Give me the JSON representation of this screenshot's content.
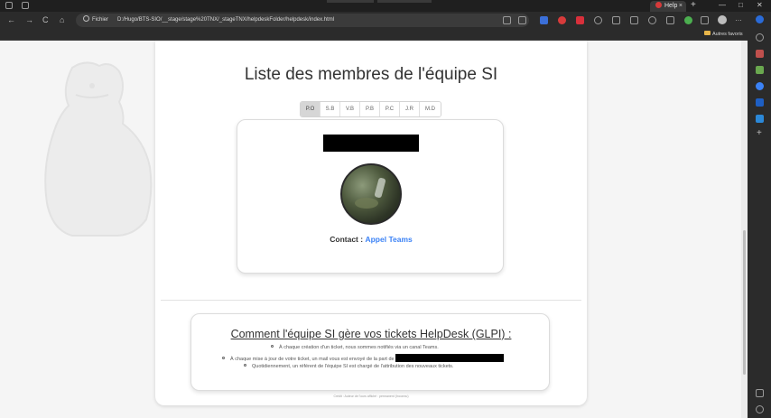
{
  "browser": {
    "tab_title": "Help",
    "tab_close": "×",
    "new_tab": "+",
    "window_controls": [
      "—",
      "□",
      "✕"
    ],
    "nav": {
      "back": "←",
      "forward": "→",
      "reload": "C",
      "home": "⌂"
    },
    "address": {
      "protocol_label": "Fichier",
      "url": "D:/Hugo/BTS-SIO/__stage/stage%20TNX/_stageTNX/helpdeskFolder/helpdesk/index.html"
    },
    "favorites_folder": "Autres favoris",
    "colors": {
      "accent": "#3b82f6",
      "dark": "#2b2b2b"
    }
  },
  "page": {
    "title": "Liste des membres de l'équipe SI",
    "tabs": [
      "P.O",
      "S.B",
      "V.B",
      "P.B",
      "P.C",
      "J.R",
      "M.D"
    ],
    "active_tab": "P.O",
    "member": {
      "contact_label": "Contact :",
      "contact_link": "Appel Teams"
    },
    "process": {
      "title": "Comment l'équipe SI gère vos tickets HelpDesk (GLPI) :",
      "items": [
        "À chaque création d'un ticket, nous sommes notifiés via un canal Teams.",
        "À chaque mise à jour de votre ticket, un mail vous est envoyé de la part de",
        "Quotidiennement, un référent de l'équipe SI est chargé de l'attribution des nouveaux tickets."
      ]
    },
    "credit": "Crédit : Auteur de l'ours affiché : permanent (Inconnu)"
  }
}
